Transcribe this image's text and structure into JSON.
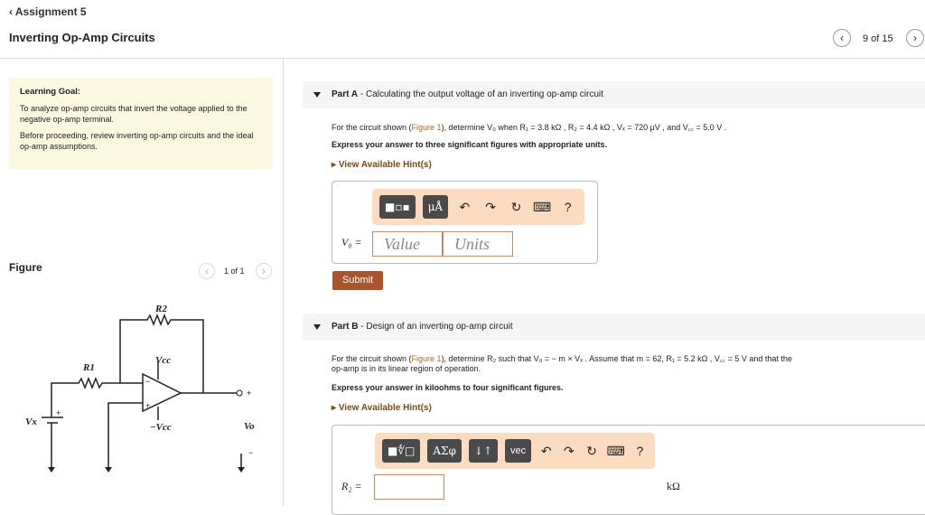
{
  "header": {
    "back_label": "Assignment 5",
    "title": "Inverting Op-Amp Circuits",
    "page_counter": "9 of 15"
  },
  "learning_goal": {
    "heading": "Learning Goal:",
    "para1": "To analyze op-amp circuits that invert the voltage applied to the negative op-amp terminal.",
    "para2": "Before proceeding, review inverting op-amp circuits and the ideal op-amp assumptions."
  },
  "figure": {
    "label": "Figure",
    "counter": "1 of 1",
    "labels": {
      "r1": "R1",
      "r2": "R2",
      "vcc": "Vcc",
      "neg_vcc": "−Vcc",
      "vx": "Vx",
      "vo": "Vo",
      "plus": "+",
      "minus": "−"
    }
  },
  "part_a": {
    "label": "Part A",
    "title": "Calculating the output voltage of an inverting op-amp circuit",
    "q_pre": "For the circuit shown (",
    "fig_link": "Figure 1",
    "q_post": "), determine V₀ when R₁ = 3.8 kΩ , R₂ = 4.4 kΩ , Vₓ = 720 μV , and V꜀꜀ = 5.0 V .",
    "instruction": "Express your answer to three significant figures with appropriate units.",
    "hint": "View Available Hint(s)",
    "toolbar": [
      "templates",
      "μÅ",
      "undo",
      "redo",
      "reset",
      "keyboard",
      "?"
    ],
    "var_label": "V₀ =",
    "value_placeholder": "Value",
    "units_placeholder": "Units",
    "submit": "Submit"
  },
  "part_b": {
    "label": "Part B",
    "title": "Design of an inverting op-amp circuit",
    "q_pre": "For the circuit shown (",
    "fig_link": "Figure 1",
    "q_post": "), determine R₂ such that V₀ = − m × Vₓ . Assume that m = 62, R₁ = 5.2 kΩ , V꜀꜀ = 5 V and that the",
    "q_line2": "op-amp is in its linear region of operation.",
    "instruction": "Express your answer in kiloohms to four significant figures.",
    "hint": "View Available Hint(s)",
    "toolbar": [
      "templates",
      "ΑΣφ",
      "↓↑",
      "vec",
      "undo",
      "redo",
      "reset",
      "keyboard",
      "?"
    ],
    "var_label": "R₂ =",
    "unit": "kΩ"
  }
}
